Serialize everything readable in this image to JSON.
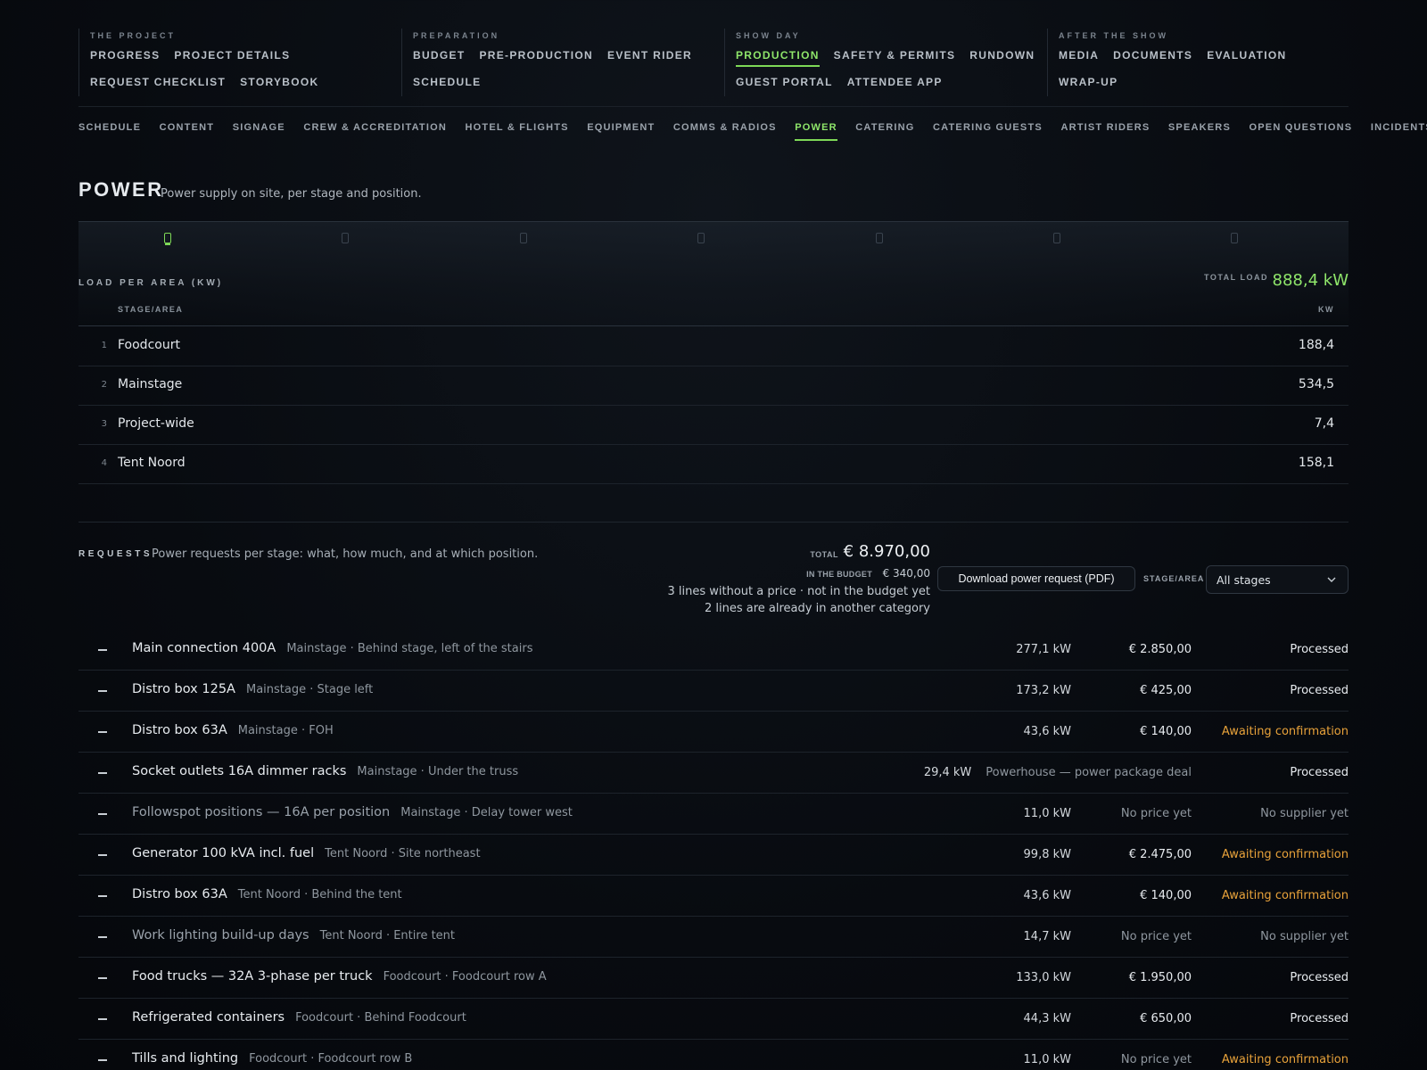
{
  "topnav": {
    "groups": [
      {
        "label": "THE PROJECT",
        "items": [
          {
            "label": "PROGRESS"
          },
          {
            "label": "PROJECT DETAILS"
          },
          {
            "label": "REQUEST CHECKLIST"
          },
          {
            "label": "STORYBOOK"
          }
        ]
      },
      {
        "label": "PREPARATION",
        "items": [
          {
            "label": "BUDGET"
          },
          {
            "label": "PRE-PRODUCTION"
          },
          {
            "label": "EVENT RIDER"
          },
          {
            "label": "SCHEDULE"
          }
        ]
      },
      {
        "label": "SHOW DAY",
        "items": [
          {
            "label": "PRODUCTION",
            "active": true
          },
          {
            "label": "SAFETY & PERMITS"
          },
          {
            "label": "RUNDOWN"
          },
          {
            "label": "GUEST PORTAL"
          },
          {
            "label": "ATTENDEE APP"
          }
        ]
      },
      {
        "label": "AFTER THE SHOW",
        "items": [
          {
            "label": "MEDIA"
          },
          {
            "label": "DOCUMENTS"
          },
          {
            "label": "EVALUATION"
          },
          {
            "label": "WRAP-UP"
          }
        ]
      }
    ]
  },
  "subnav": [
    "SCHEDULE",
    "CONTENT",
    "SIGNAGE",
    "CREW & ACCREDITATION",
    "HOTEL & FLIGHTS",
    "EQUIPMENT",
    "COMMS & RADIOS",
    "POWER",
    "CATERING",
    "CATERING GUESTS",
    "ARTIST RIDERS",
    "SPEAKERS",
    "OPEN QUESTIONS",
    "INCIDENTS"
  ],
  "subnav_active": "POWER",
  "page": {
    "title": "POWER",
    "subtitle": "Power supply on site, per stage and position."
  },
  "load": {
    "label": "LOAD PER AREA (KW)",
    "total_label": "TOTAL LOAD",
    "total_value": "888,4 kW",
    "col_area": "STAGE/AREA",
    "col_kw": "KW",
    "rows": [
      {
        "idx": "1",
        "name": "Foodcourt",
        "kw": "188,4"
      },
      {
        "idx": "2",
        "name": "Mainstage",
        "kw": "534,5"
      },
      {
        "idx": "3",
        "name": "Project-wide",
        "kw": "7,4"
      },
      {
        "idx": "4",
        "name": "Tent Noord",
        "kw": "158,1"
      }
    ]
  },
  "requests": {
    "label": "REQUESTS",
    "subtitle": "Power requests per stage: what, how much, and at which position.",
    "total_label": "TOTAL",
    "total_value": "€ 8.970,00",
    "budget_label": "IN THE BUDGET",
    "budget_value": "€ 340,00",
    "note1": "3 lines without a price · not in the budget yet",
    "note2": "2 lines are already in another category",
    "pdf_button": "Download power request (PDF)",
    "stage_label": "STAGE/AREA",
    "stage_select": "All stages",
    "rows": [
      {
        "title": "Main connection 400A",
        "loc": "Mainstage · Behind stage, left of the stairs",
        "kw": "277,1 kW",
        "price": "€ 2.850,00",
        "status": "Processed",
        "state": "ok"
      },
      {
        "title": "Distro box 125A",
        "loc": "Mainstage · Stage left",
        "kw": "173,2 kW",
        "price": "€ 425,00",
        "status": "Processed",
        "state": "ok"
      },
      {
        "title": "Distro box 63A",
        "loc": "Mainstage · FOH",
        "kw": "43,6 kW",
        "price": "€ 140,00",
        "status": "Awaiting confirmation",
        "state": "await"
      },
      {
        "title": "Socket outlets 16A dimmer racks",
        "loc": "Mainstage · Under the truss",
        "kw": "29,4 kW",
        "price": "Powerhouse — power package deal",
        "status": "Processed",
        "state": "ok"
      },
      {
        "title": "Followspot positions — 16A per position",
        "loc": "Mainstage · Delay tower west",
        "kw": "11,0 kW",
        "price": "No price yet",
        "status": "No supplier yet",
        "state": "none"
      },
      {
        "title": "Generator 100 kVA incl. fuel",
        "loc": "Tent Noord · Site northeast",
        "kw": "99,8 kW",
        "price": "€ 2.475,00",
        "status": "Awaiting confirmation",
        "state": "await"
      },
      {
        "title": "Distro box 63A",
        "loc": "Tent Noord · Behind the tent",
        "kw": "43,6 kW",
        "price": "€ 140,00",
        "status": "Awaiting confirmation",
        "state": "await"
      },
      {
        "title": "Work lighting build-up days",
        "loc": "Tent Noord · Entire tent",
        "kw": "14,7 kW",
        "price": "No price yet",
        "status": "No supplier yet",
        "state": "none"
      },
      {
        "title": "Food trucks — 32A 3-phase per truck",
        "loc": "Foodcourt · Foodcourt row A",
        "kw": "133,0 kW",
        "price": "€ 1.950,00",
        "status": "Processed",
        "state": "ok"
      },
      {
        "title": "Refrigerated containers",
        "loc": "Foodcourt · Behind Foodcourt",
        "kw": "44,3 kW",
        "price": "€ 650,00",
        "status": "Processed",
        "state": "ok"
      },
      {
        "title": "Tills and lighting",
        "loc": "Foodcourt · Foodcourt row B",
        "kw": "11,0 kW",
        "price": "No price yet",
        "status": "Awaiting confirmation",
        "state": "await"
      }
    ]
  },
  "colors": {
    "accent": "#7ed957",
    "awaiting": "#e8a23a",
    "background": "#080b10"
  }
}
